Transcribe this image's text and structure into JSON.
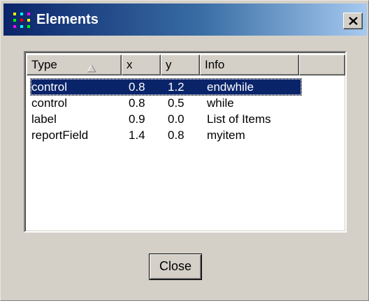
{
  "window": {
    "title": "Elements",
    "title_bar_colors": [
      "#0a246a",
      "#a6caf0"
    ],
    "title_icon": "grid-dots-icon",
    "close_icon": "close-icon"
  },
  "table": {
    "columns": [
      {
        "label": "Type",
        "sorted": "ascending"
      },
      {
        "label": "x"
      },
      {
        "label": "y"
      },
      {
        "label": "Info"
      }
    ],
    "rows": [
      {
        "type": "control",
        "x": "0.8",
        "y": "1.2",
        "info": "endwhile",
        "selected": true
      },
      {
        "type": "control",
        "x": "0.8",
        "y": "0.5",
        "info": "while",
        "selected": false
      },
      {
        "type": "label",
        "x": "0.9",
        "y": "0.0",
        "info": "List of Items",
        "selected": false
      },
      {
        "type": "reportField",
        "x": "1.4",
        "y": "0.8",
        "info": "myitem",
        "selected": false
      }
    ],
    "selection_color": "#0a246a"
  },
  "buttons": {
    "close_label": "Close"
  }
}
